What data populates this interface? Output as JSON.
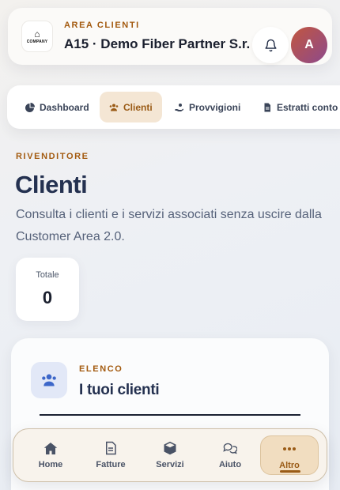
{
  "header": {
    "logo_text": "COMPANY",
    "area_label": "AREA CLIENTI",
    "company_name": "A15 · Demo Fiber Partner S.r.l.",
    "avatar_initial": "A"
  },
  "tabs": [
    {
      "label": "Dashboard",
      "icon": "pie-chart-icon",
      "active": false
    },
    {
      "label": "Clienti",
      "icon": "users-icon",
      "active": true
    },
    {
      "label": "Provvigioni",
      "icon": "hand-coin-icon",
      "active": false
    },
    {
      "label": "Estratti conto",
      "icon": "document-icon",
      "active": false
    }
  ],
  "page": {
    "eyebrow": "RIVENDITORE",
    "title": "Clienti",
    "description": "Consulta i clienti e i servizi associati senza uscire dalla Customer Area 2.0."
  },
  "stats": {
    "total_label": "Totale",
    "total_value": "0"
  },
  "list": {
    "eyebrow": "ELENCO",
    "title": "I tuoi clienti"
  },
  "bottom_nav": [
    {
      "label": "Home",
      "icon": "home-icon",
      "active": false
    },
    {
      "label": "Fatture",
      "icon": "invoice-icon",
      "active": false
    },
    {
      "label": "Servizi",
      "icon": "box-icon",
      "active": false
    },
    {
      "label": "Aiuto",
      "icon": "chat-icon",
      "active": false
    },
    {
      "label": "Altro",
      "icon": "more-icon",
      "active": true
    }
  ],
  "colors": {
    "accent": "#a35a0f",
    "active_tab_bg": "#f4e6d4",
    "title": "#243150"
  }
}
